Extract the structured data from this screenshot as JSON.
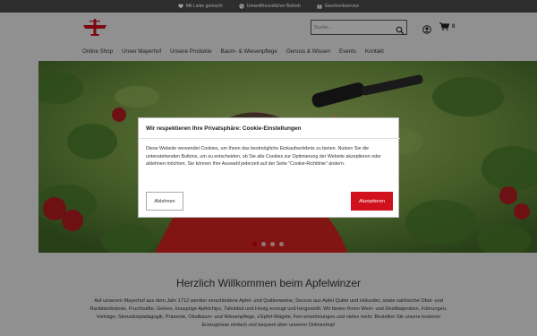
{
  "topbar": {
    "items": [
      {
        "icon": "heart-icon",
        "label": "Mit Liebe gemacht"
      },
      {
        "icon": "globe-icon",
        "label": "Umweltfreundlicher Betrieb"
      },
      {
        "icon": "gift-icon",
        "label": "Geschenkservice"
      }
    ]
  },
  "header": {
    "logo": "plane-logo",
    "search_placeholder": "Suche...",
    "cart_count": "0"
  },
  "nav": {
    "items": [
      "Online Shop",
      "Unser Mayerhof",
      "Unsere Produkte",
      "Baum- & Wiesenpflege",
      "Genuss & Wissen",
      "Events",
      "Kontakt"
    ]
  },
  "hero": {
    "slide_count": 4,
    "active_slide": 1
  },
  "cookie_modal": {
    "title": "Wir respektieren Ihre Privatsphäre: Cookie-Einstellungen",
    "text": "Diese Website verwendet Cookies, um Ihnen das bestmögliche Einkaufserlebnis zu bieten. Nutzen Sie die untenstehenden Buttons, um zu entscheiden, ob Sie alle Cookies zur Optimierung der Website akzeptieren oder ablehnen möchten. Sie können Ihre Auswahl jederzeit auf der Seite \"Cookie-Richtlinie\" ändern.",
    "decline_label": "Ablehnen",
    "accept_label": "Akzeptieren"
  },
  "welcome": {
    "title": "Herzlich Willkommen beim Apfelwinzer",
    "text": "Auf unserem Mayerhof aus dem Jahr 1712 werden verschiedene Apfel- und Quittenweine, Seccos aus Apfel Quitte und Holunder, sowie zahlreiche Obst- und Raritätenbrände, Fruchtsäfte, Gelees, knusprige Apfelchips, Tafelobst und Honig erzeugt und hergestellt. Wir bieten Ihnen Wein- und Destillatproben, Führungen, Vorträge, Streuobstpädagogik, Präsente, Obstbaum- und Wiesenpflege, s'Epfel-Wägele, Feri-enwohnungen und vieles mehr. Bestellen Sie unsere leckeren Erzeugnisse einfach und bequem über unseren Onlineshop!"
  },
  "colors": {
    "accent": "#d0101d",
    "topbar": "#4a4a4a",
    "background": "#e9e9e9"
  }
}
